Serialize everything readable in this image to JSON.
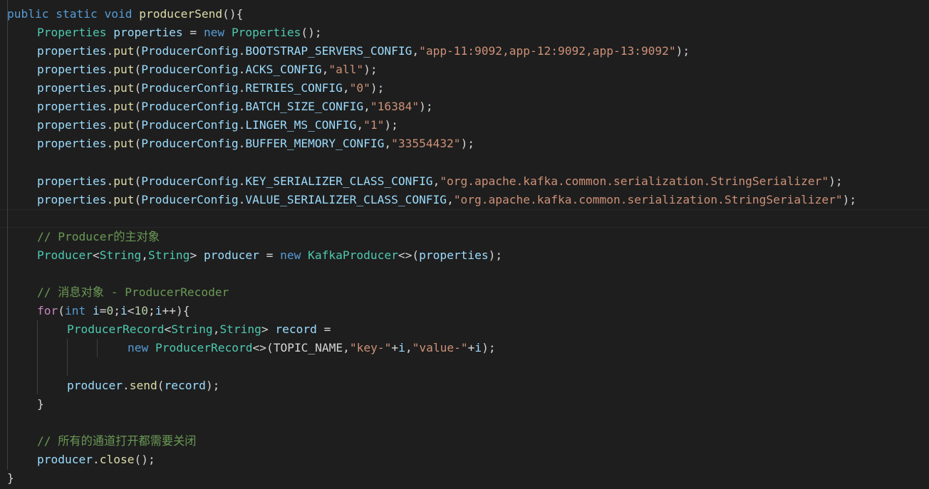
{
  "code": {
    "l1": {
      "a": "public",
      "b": " ",
      "c": "static",
      "d": " ",
      "e": "void",
      "f": " ",
      "g": "producerSend",
      "h": "(){"
    },
    "l2": {
      "a": "Properties",
      "b": " ",
      "c": "properties",
      "d": " = ",
      "e": "new",
      "f": " ",
      "g": "Properties",
      "h": "();"
    },
    "l3": {
      "a": "properties",
      "b": ".",
      "c": "put",
      "d": "(",
      "e": "ProducerConfig",
      "f": ".",
      "g": "BOOTSTRAP_SERVERS_CONFIG",
      "h": ",",
      "i": "\"app-11:9092,app-12:9092,app-13:9092\"",
      "j": ");"
    },
    "l4": {
      "a": "properties",
      "b": ".",
      "c": "put",
      "d": "(",
      "e": "ProducerConfig",
      "f": ".",
      "g": "ACKS_CONFIG",
      "h": ",",
      "i": "\"all\"",
      "j": ");"
    },
    "l5": {
      "a": "properties",
      "b": ".",
      "c": "put",
      "d": "(",
      "e": "ProducerConfig",
      "f": ".",
      "g": "RETRIES_CONFIG",
      "h": ",",
      "i": "\"0\"",
      "j": ");"
    },
    "l6": {
      "a": "properties",
      "b": ".",
      "c": "put",
      "d": "(",
      "e": "ProducerConfig",
      "f": ".",
      "g": "BATCH_SIZE_CONFIG",
      "h": ",",
      "i": "\"16384\"",
      "j": ");"
    },
    "l7": {
      "a": "properties",
      "b": ".",
      "c": "put",
      "d": "(",
      "e": "ProducerConfig",
      "f": ".",
      "g": "LINGER_MS_CONFIG",
      "h": ",",
      "i": "\"1\"",
      "j": ");"
    },
    "l8": {
      "a": "properties",
      "b": ".",
      "c": "put",
      "d": "(",
      "e": "ProducerConfig",
      "f": ".",
      "g": "BUFFER_MEMORY_CONFIG",
      "h": ",",
      "i": "\"33554432\"",
      "j": ");"
    },
    "l10": {
      "a": "properties",
      "b": ".",
      "c": "put",
      "d": "(",
      "e": "ProducerConfig",
      "f": ".",
      "g": "KEY_SERIALIZER_CLASS_CONFIG",
      "h": ",",
      "i": "\"org.apache.kafka.common.serialization.StringSerializer\"",
      "j": ");"
    },
    "l11": {
      "a": "properties",
      "b": ".",
      "c": "put",
      "d": "(",
      "e": "ProducerConfig",
      "f": ".",
      "g": "VALUE_SERIALIZER_CLASS_CONFIG",
      "h": ",",
      "i": "\"org.apache.kafka.common.serialization.StringSerializer\"",
      "j": ");"
    },
    "l13": {
      "a": "// Producer的主对象"
    },
    "l14": {
      "a": "Producer",
      "b": "<",
      "c": "String",
      "d": ",",
      "e": "String",
      "f": "> ",
      "g": "producer",
      "h": " = ",
      "i": "new",
      "j": " ",
      "k": "KafkaProducer",
      "l": "<>(",
      "m": "properties",
      "n": ");"
    },
    "l16": {
      "a": "// 消息对象 - ProducerRecoder"
    },
    "l17": {
      "a": "for",
      "b": "(",
      "c": "int",
      "d": " ",
      "e": "i",
      "f": "=",
      "g": "0",
      "h": ";",
      "i": "i",
      "j": "<",
      "k": "10",
      "l": ";",
      "m": "i",
      "n": "++",
      "o": "){"
    },
    "l18": {
      "a": "ProducerRecord",
      "b": "<",
      "c": "String",
      "d": ",",
      "e": "String",
      "f": "> ",
      "g": "record",
      "h": " ="
    },
    "l19": {
      "a": "new",
      "b": " ",
      "c": "ProducerRecord",
      "d": "<>(",
      "e": "TOPIC_NAME",
      "f": ",",
      "g": "\"key-\"",
      "h": "+",
      "i": "i",
      "j": ",",
      "k": "\"value-\"",
      "l": "+",
      "m": "i",
      "n": ");"
    },
    "l21": {
      "a": "producer",
      "b": ".",
      "c": "send",
      "d": "(",
      "e": "record",
      "f": ");"
    },
    "l22": {
      "a": "}"
    },
    "l24": {
      "a": "// 所有的通道打开都需要关闭"
    },
    "l25": {
      "a": "producer",
      "b": ".",
      "c": "close",
      "d": "();"
    },
    "l26": {
      "a": "}"
    }
  }
}
